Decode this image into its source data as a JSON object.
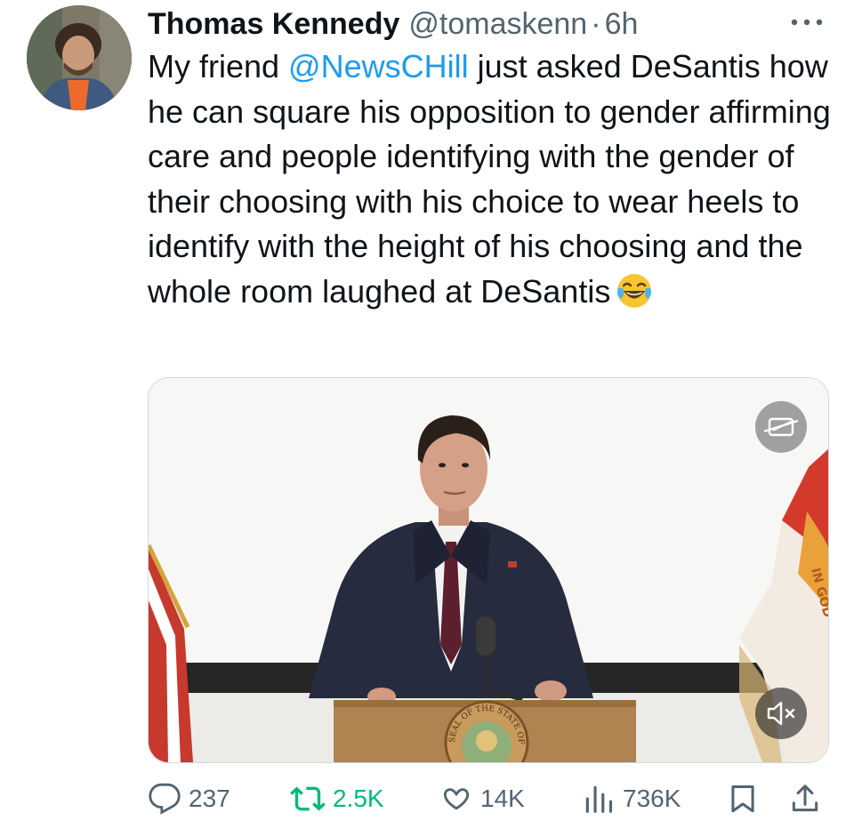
{
  "tweet": {
    "author": {
      "display_name": "Thomas Kennedy",
      "handle": "@tomaskenn"
    },
    "separator": "·",
    "timestamp": "6h",
    "text_before_mention": "My friend ",
    "mention": "@NewsCHill",
    "text_after_mention": " just asked DeSantis how he can square his opposition to gender affirming care and people identifying with the gender of their choosing with his choice to wear heels to identify with the height of his choosing and the whole room laughed at DeSantis",
    "emoji": "face-with-tears-of-joy",
    "media": {
      "type": "video",
      "podium_seal_text": "SEAL OF THE STATE OF FLORIDA",
      "flag_text": "IN GOD"
    },
    "stats": {
      "replies": "237",
      "retweets": "2.5K",
      "likes": "14K",
      "views": "736K"
    }
  },
  "colors": {
    "text": "#0f1419",
    "secondary": "#536471",
    "link": "#1d9bf0",
    "retweet_active": "#00ba7c"
  },
  "icons": [
    "more-icon",
    "reply-icon",
    "retweet-icon",
    "like-icon",
    "views-icon",
    "bookmark-icon",
    "share-icon",
    "captions-icon",
    "mute-icon"
  ]
}
